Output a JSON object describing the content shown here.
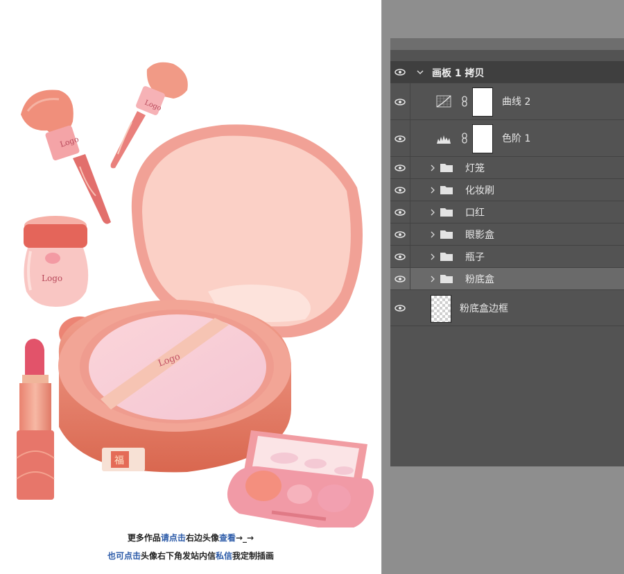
{
  "caption": {
    "line1": [
      {
        "text": "更多作品",
        "color": "dark"
      },
      {
        "text": "请点击",
        "color": "blue"
      },
      {
        "text": "右边头像",
        "color": "dark"
      },
      {
        "text": "查看",
        "color": "blue"
      },
      {
        "text": "→_→",
        "color": "dark"
      }
    ],
    "line2": [
      {
        "text": "也可点击",
        "color": "blue"
      },
      {
        "text": "头像右下角发站内信",
        "color": "dark"
      },
      {
        "text": "私信",
        "color": "blue"
      },
      {
        "text": "我",
        "color": "dark"
      },
      {
        "text": "定制插画",
        "color": "dark"
      }
    ]
  },
  "illustration": {
    "brush_logo_1": "Logo",
    "brush_logo_2": "Logo",
    "jar_logo": "Logo",
    "compact_logo": "Logo",
    "fu_label": "福"
  },
  "layers_panel": {
    "group": {
      "name": "画板 1 拷贝"
    },
    "adjustments": [
      {
        "name": "曲线 2",
        "icon": "curves-icon"
      },
      {
        "name": "色阶 1",
        "icon": "levels-icon"
      }
    ],
    "folders": [
      {
        "name": "灯笼"
      },
      {
        "name": "化妆刷"
      },
      {
        "name": "口红"
      },
      {
        "name": "眼影盒"
      },
      {
        "name": "瓶子"
      },
      {
        "name": "粉底盒",
        "selected": true
      }
    ],
    "bottom_layer": {
      "name": "粉底盒边框"
    }
  },
  "colors": {
    "panel_bg": "#535353",
    "selected_row": "#6a6a6a",
    "caption_blue": "#2b5aa8",
    "compact_pink": "#f1a196",
    "compact_inner": "#fbd0c6"
  }
}
